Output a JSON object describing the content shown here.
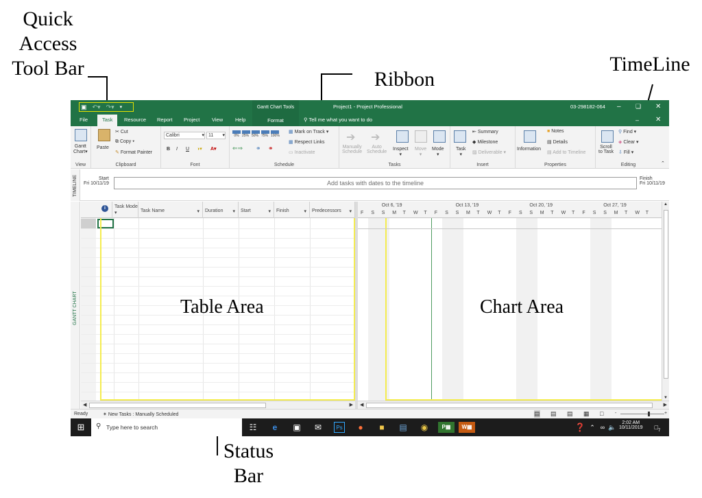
{
  "annotations": {
    "qat": [
      "Quick",
      "Access",
      "Tool Bar"
    ],
    "ribbon": "Ribbon",
    "timeline": "TimeLine",
    "status": [
      "Status",
      "Bar"
    ],
    "table_area": "Table Area",
    "chart_area": "Chart Area"
  },
  "titlebar": {
    "tools": "Gantt Chart Tools",
    "title": "Project1  -  Project Professional",
    "id": "03-298182-064"
  },
  "tabs": [
    "File",
    "Task",
    "Resource",
    "Report",
    "Project",
    "View",
    "Help"
  ],
  "active_tab": "Task",
  "format_tab": "Format",
  "tellme": "Tell me what you want to do",
  "ribbon": {
    "view": {
      "gantt": "Gantt",
      "chart": "Chart",
      "label": "View"
    },
    "clipboard": {
      "paste": "Paste",
      "cut": "Cut",
      "copy": "Copy",
      "format_painter": "Format Painter",
      "label": "Clipboard"
    },
    "font": {
      "name": "Calibri",
      "size": "11",
      "bold": "B",
      "italic": "I",
      "underline": "U",
      "label": "Font"
    },
    "schedule": {
      "pcts": [
        "0%",
        "25%",
        "50%",
        "75%",
        "100%"
      ],
      "mark_on_track": "Mark on Track",
      "respect_links": "Respect Links",
      "inactivate": "Inactivate",
      "label": "Schedule"
    },
    "tasks": {
      "manually": "Manually",
      "manually2": "Schedule",
      "auto": "Auto",
      "auto2": "Schedule",
      "inspect": "Inspect",
      "move": "Move",
      "mode": "Mode",
      "label": "Tasks"
    },
    "insert": {
      "task": "Task",
      "summary": "Summary",
      "milestone": "Milestone",
      "deliverable": "Deliverable",
      "label": "Insert"
    },
    "properties": {
      "information": "Information",
      "notes": "Notes",
      "details": "Details",
      "add_to_timeline": "Add to Timeline",
      "label": "Properties"
    },
    "editing": {
      "scroll": "Scroll",
      "to_task": "to Task",
      "find": "Find",
      "clear": "Clear",
      "fill": "Fill",
      "label": "Editing"
    }
  },
  "timeline": {
    "side_label": "TIMELINE",
    "start_label": "Start",
    "start_date": "Fri 10/11/19",
    "finish_label": "Finish",
    "finish_date": "Fri 10/11/19",
    "placeholder": "Add tasks with dates to the timeline"
  },
  "gantt_side_label": "GANTT CHART",
  "table": {
    "info": "i",
    "columns": [
      "Task Mode",
      "Task Name",
      "Duration",
      "Start",
      "Finish",
      "Predecessors"
    ]
  },
  "chart": {
    "weeks": [
      "Oct 6, '19",
      "Oct 13, '19",
      "Oct 20, '19",
      "Oct 27, '19"
    ],
    "days": [
      "F",
      "S",
      "S",
      "M",
      "T",
      "W",
      "T",
      "F",
      "S",
      "S",
      "M",
      "T",
      "W",
      "T",
      "F",
      "S",
      "S",
      "M",
      "T",
      "W",
      "T",
      "F",
      "S",
      "S",
      "M",
      "T",
      "W",
      "T"
    ]
  },
  "status": {
    "ready": "Ready",
    "new_tasks": "New Tasks : Manually Scheduled",
    "zoom_minus": "-",
    "zoom_plus": "+"
  },
  "taskbar": {
    "search": "Type here to search",
    "time": "2:02 AM",
    "date": "10/11/2019",
    "notif": "7"
  }
}
